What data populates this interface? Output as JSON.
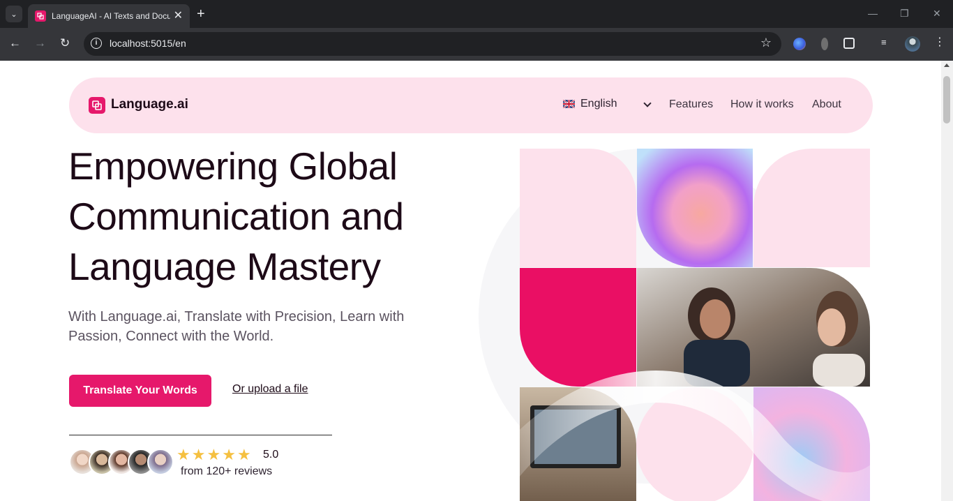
{
  "browser": {
    "tab_title": "LanguageAI - AI Texts and Docu",
    "url": "localhost:5015/en",
    "new_tab": "+",
    "tab_close": "✕"
  },
  "navbar": {
    "logo_text": "Language.ai",
    "language": "English",
    "links": [
      "Features",
      "How it works",
      "About"
    ]
  },
  "hero": {
    "title": "Empowering Global Communication and Language Mastery",
    "subtitle": "With Language.ai, Translate with Precision, Learn with Passion, Connect with the World.",
    "primary_cta": "Translate Your Words",
    "secondary_cta": "Or upload a file",
    "rating": "5.0",
    "rating_stars": 5,
    "reviews": "from 120+ reviews"
  },
  "colors": {
    "accent": "#e6186b",
    "nav_bg": "#fde1ec",
    "text_dark": "#1d0a17",
    "star": "#f5c040"
  }
}
